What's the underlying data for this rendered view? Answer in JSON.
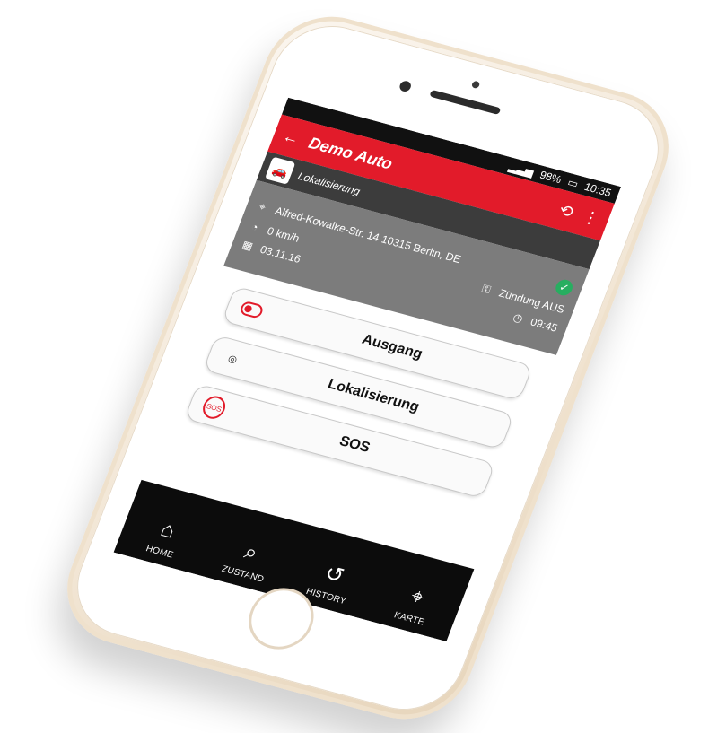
{
  "status_bar": {
    "battery_percent": "98%",
    "time": "10:35"
  },
  "app_bar": {
    "back_icon": "arrow-left-icon",
    "title": "Demo Auto",
    "refresh_icon": "refresh-icon",
    "menu_icon": "more-vert-icon"
  },
  "device": {
    "icon": "car-icon",
    "label": "Lokalisierung"
  },
  "info": {
    "address": "Alfred-Kowalke-Str. 14 10315 Berlin, DE",
    "speed": "0 km/h",
    "ignition": "Zündung AUS",
    "date": "03.11.16",
    "time": "09:45"
  },
  "actions": [
    {
      "label": "Ausgang",
      "icon": "toggle-icon"
    },
    {
      "label": "Lokalisierung",
      "icon": "locate-icon"
    },
    {
      "label": "SOS",
      "icon": "sos-icon"
    }
  ],
  "tabs": [
    {
      "label": "HOME",
      "icon": "home-icon"
    },
    {
      "label": "ZUSTAND",
      "icon": "search-info-icon"
    },
    {
      "label": "HISTORY",
      "icon": "history-icon"
    },
    {
      "label": "KARTE",
      "icon": "map-icon"
    }
  ],
  "colors": {
    "accent": "#e21b2a",
    "dark": "#3c3c3c",
    "info_bg": "#7c7c7c",
    "tabbar": "#0c0c0c",
    "ok": "#27ae60"
  }
}
